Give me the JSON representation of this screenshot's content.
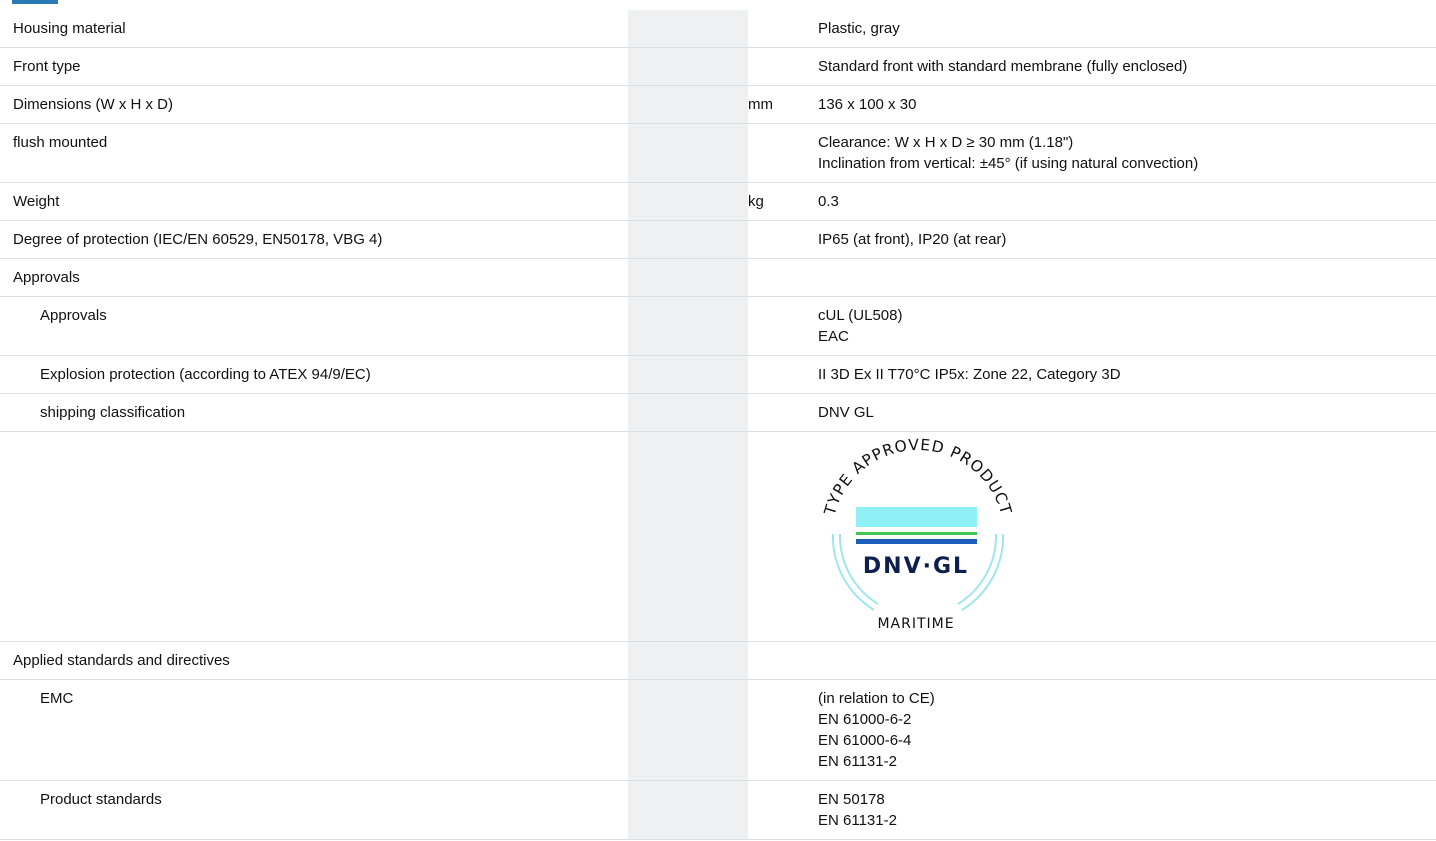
{
  "rows": [
    {
      "label": "Housing material",
      "unit": "",
      "values": [
        "Plastic, gray"
      ],
      "sub": false
    },
    {
      "label": "Front type",
      "unit": "",
      "values": [
        "Standard front with standard membrane (fully enclosed)"
      ],
      "sub": false
    },
    {
      "label": "Dimensions (W x H x D)",
      "unit": "mm",
      "values": [
        "136 x 100 x 30"
      ],
      "sub": false
    },
    {
      "label": "flush mounted",
      "unit": "",
      "values": [
        "Clearance: W x H x D ≥ 30 mm (1.18\")",
        "Inclination from vertical: ±45° (if using natural convection)"
      ],
      "sub": false
    },
    {
      "label": "Weight",
      "unit": "kg",
      "values": [
        "0.3"
      ],
      "sub": false
    },
    {
      "label": "Degree of protection (IEC/EN 60529, EN50178, VBG 4)",
      "unit": "",
      "values": [
        "IP65 (at front), IP20 (at rear)"
      ],
      "sub": false
    },
    {
      "label": "Approvals",
      "unit": "",
      "values": [],
      "sub": false
    },
    {
      "label": "Approvals",
      "unit": "",
      "values": [
        "cUL (UL508)",
        "EAC"
      ],
      "sub": true
    },
    {
      "label": "Explosion protection (according to ATEX 94/9/EC)",
      "unit": "",
      "values": [
        "II 3D Ex II T70°C IP5x: Zone 22, Category 3D"
      ],
      "sub": true
    },
    {
      "label": "shipping classification",
      "unit": "",
      "values": [
        "DNV GL"
      ],
      "sub": true
    },
    {
      "logo": true
    },
    {
      "label": "Applied standards and directives",
      "unit": "",
      "values": [],
      "sub": false
    },
    {
      "label": "EMC",
      "unit": "",
      "values": [
        "(in relation to CE)",
        "EN 61000-6-2",
        "EN 61000-6-4",
        "EN 61131-2"
      ],
      "sub": true
    },
    {
      "label": "Product standards",
      "unit": "",
      "values": [
        "EN 50178",
        "EN 61131-2"
      ],
      "sub": true
    }
  ],
  "logo": {
    "arc_text": "TYPE APPROVED PRODUCT",
    "brand": "DNV·GL",
    "footer": "MARITIME",
    "colors": {
      "cyan": "#8ff0f5",
      "green": "#43c64f",
      "blue": "#1b5fb8",
      "navy": "#0d1f4f",
      "ring": "#9fe6ef"
    }
  }
}
